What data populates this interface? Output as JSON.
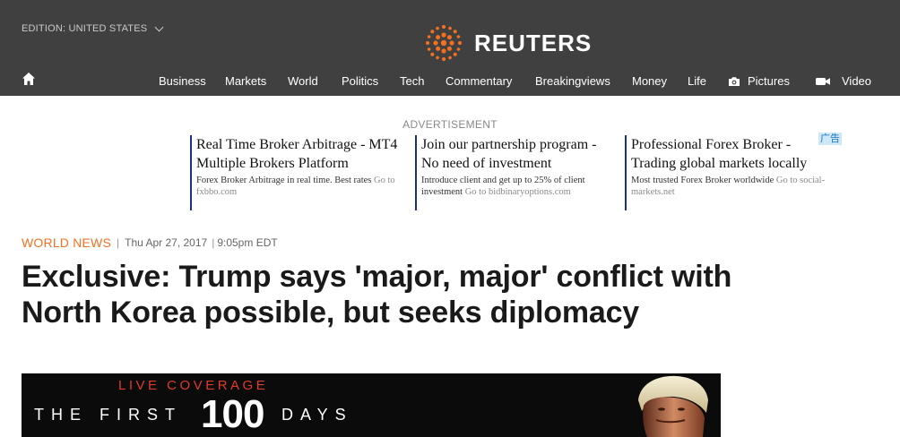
{
  "header": {
    "edition_label": "EDITION: UNITED STATES",
    "logo_text": "REUTERS",
    "nav": [
      {
        "label": "Business"
      },
      {
        "label": "Markets"
      },
      {
        "label": "World"
      },
      {
        "label": "Politics"
      },
      {
        "label": "Tech"
      },
      {
        "label": "Commentary"
      },
      {
        "label": "Breakingviews"
      },
      {
        "label": "Money"
      },
      {
        "label": "Life"
      },
      {
        "label": "Pictures",
        "icon": "camera-icon"
      },
      {
        "label": "Video",
        "icon": "video-icon"
      }
    ]
  },
  "ad": {
    "label": "ADVERTISEMENT",
    "badge": "广告",
    "items": [
      {
        "title": "Real Time Broker Arbitrage - MT4 Multiple Brokers Platform",
        "desc": "Forex Broker Arbitrage in real time. Best rates",
        "goto": "Go to fxbbo.com"
      },
      {
        "title": "Join our partnership program - No need of investment",
        "desc": "Introduce client and get up to 25% of client investment",
        "goto": "Go to bidbinaryoptions.com"
      },
      {
        "title": "Professional Forex Broker - Trading global markets locally",
        "desc": "Most trusted Forex Broker worldwide",
        "goto": "Go to social-markets.net"
      }
    ]
  },
  "article": {
    "section": "WORLD NEWS",
    "date": "Thu Apr 27, 2017",
    "time": "9:05pm EDT",
    "headline": "Exclusive: Trump says 'major, major' conflict with North Korea possible, but seeks diplomacy"
  },
  "banner": {
    "live": "LIVE COVERAGE",
    "first": "THE FIRST",
    "number": "100",
    "days": "DAYS"
  },
  "colors": {
    "header_bg": "#404040",
    "accent": "#f37021",
    "ad_border": "#1a2f8a",
    "live_red": "#e03a2b"
  }
}
